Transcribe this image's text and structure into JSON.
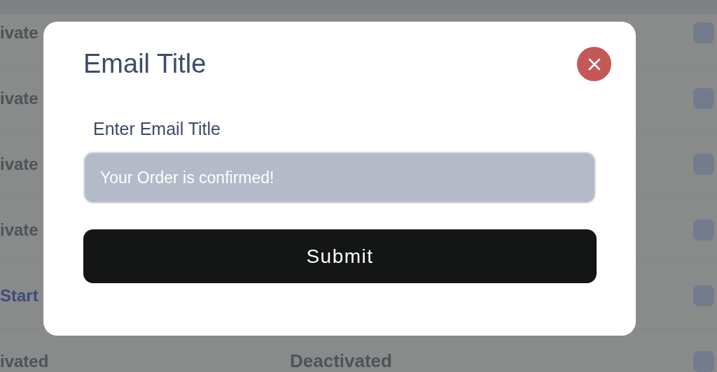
{
  "background_table": {
    "rows": [
      {
        "column_1": "ivate",
        "link": false
      },
      {
        "column_1": "ivate",
        "link": false
      },
      {
        "column_1": "ivate",
        "link": false
      },
      {
        "column_1": "ivate",
        "link": false
      },
      {
        "column_1": "Start",
        "link": true
      },
      {
        "column_1": "ivated",
        "link": false,
        "column_2": "Deactivated"
      }
    ]
  },
  "modal": {
    "title": "Email Title",
    "field": {
      "label": "Enter Email Title",
      "value": "Your Order is confirmed!"
    },
    "button": "Submit"
  }
}
